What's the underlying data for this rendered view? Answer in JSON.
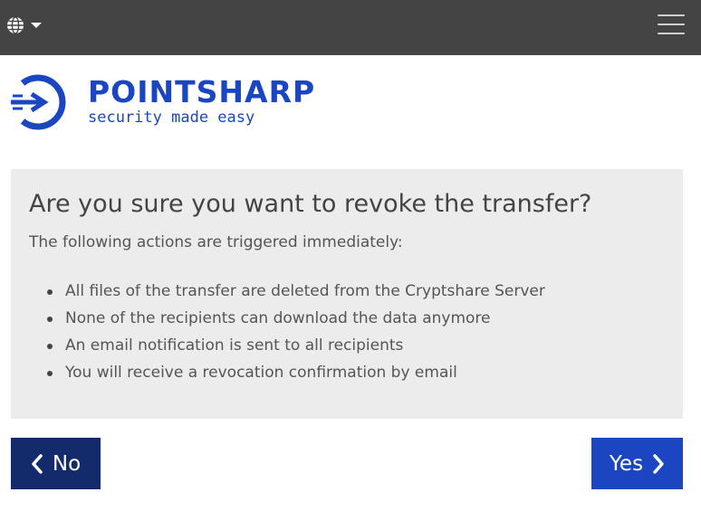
{
  "topbar": {
    "language_icon": "globe-icon",
    "dropdown_icon": "caret-down-icon",
    "menu_icon": "hamburger-menu-icon"
  },
  "logo": {
    "name": "POINTSHARP",
    "tagline": "security made easy",
    "brand_color": "#1b46c2"
  },
  "dialog": {
    "title": "Are you sure you want to revoke the transfer?",
    "intro": "The following actions are triggered immediately:",
    "actions": [
      "All files of the transfer are deleted from the Cryptshare Server",
      "None of the recipients can download the data anymore",
      "An email notification is sent to all recipients",
      "You will receive a revocation confirmation by email"
    ]
  },
  "buttons": {
    "no_label": "No",
    "no_icon": "chevron-left-icon",
    "no_color": "#132a6b",
    "yes_label": "Yes",
    "yes_icon": "chevron-right-icon",
    "yes_color": "#1b46c2"
  }
}
